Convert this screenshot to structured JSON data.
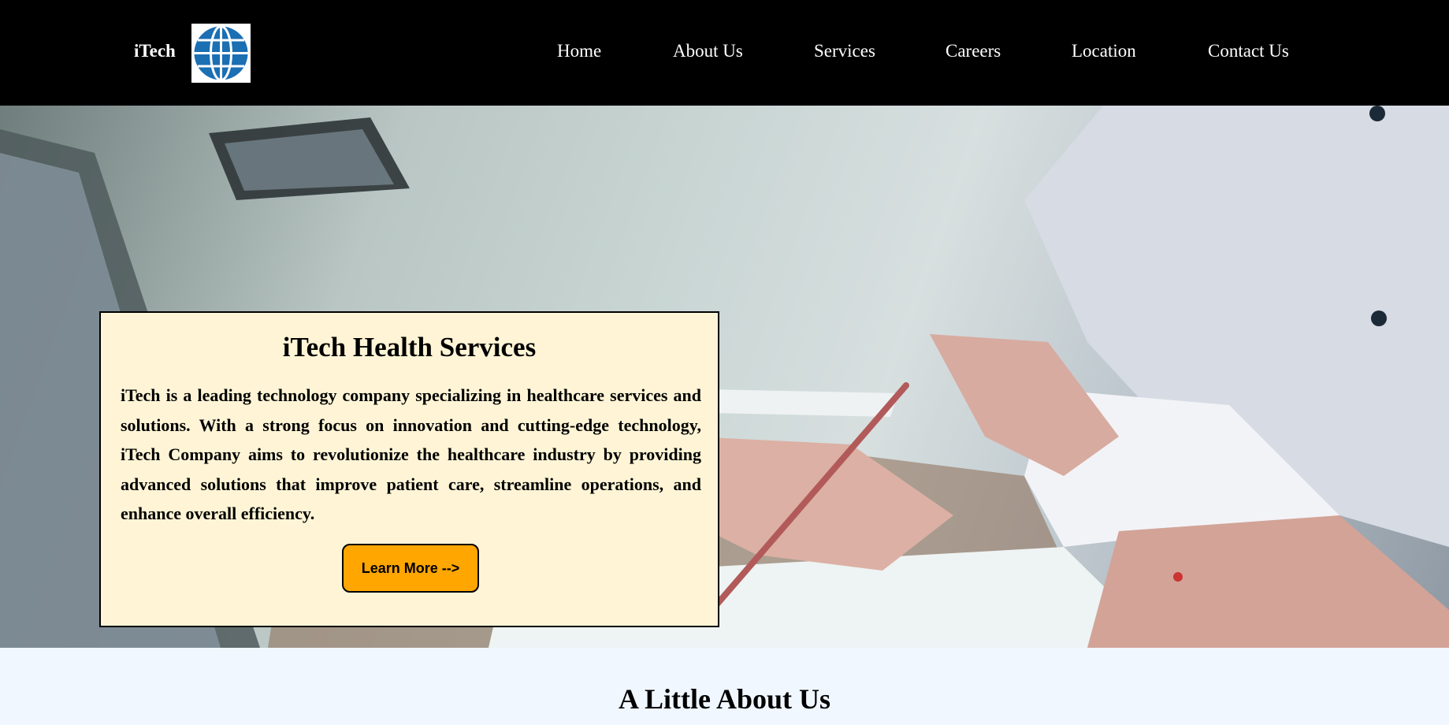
{
  "header": {
    "brand": "iTech",
    "logo_icon": "globe-icon",
    "logo_color": "#1b6fb3",
    "nav": [
      {
        "label": "Home"
      },
      {
        "label": "About Us"
      },
      {
        "label": "Services"
      },
      {
        "label": "Careers"
      },
      {
        "label": "Location"
      },
      {
        "label": "Contact Us"
      }
    ]
  },
  "hero": {
    "title": "iTech Health Services",
    "body": "iTech is a leading technology company specializing in healthcare services and solutions. With a strong focus on innovation and cutting-edge technology, iTech Company aims to revolutionize the healthcare industry by providing advanced solutions that improve patient care, streamline operations, and enhance overall efficiency.",
    "cta_label": "Learn More -->",
    "cta_color": "#ffa600",
    "card_color": "#fff5d6"
  },
  "about": {
    "heading": "A Little About Us"
  }
}
